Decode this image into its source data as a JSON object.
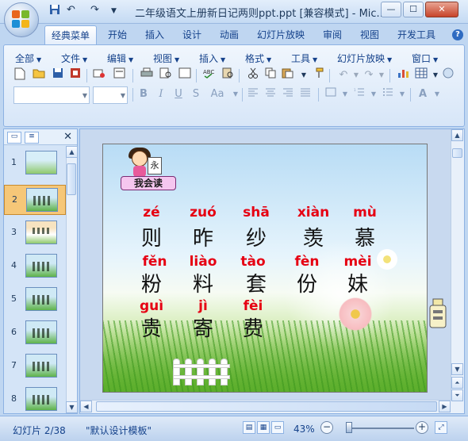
{
  "window": {
    "title": "二年级语文上册新日记两则ppt.ppt [兼容模式] - Mic...",
    "quick_access": {
      "save": "save-icon",
      "undo": "↶",
      "redo": "↷",
      "more": "▼"
    },
    "controls": {
      "min": "—",
      "max": "☐",
      "close": "✕"
    }
  },
  "tabs": [
    {
      "label": "经典菜单",
      "active": true
    },
    {
      "label": "开始"
    },
    {
      "label": "插入"
    },
    {
      "label": "设计"
    },
    {
      "label": "动画"
    },
    {
      "label": "幻灯片放映"
    },
    {
      "label": "审阅"
    },
    {
      "label": "视图"
    },
    {
      "label": "开发工具"
    }
  ],
  "help": "?",
  "menus": [
    "全部",
    "文件",
    "编辑",
    "视图",
    "插入",
    "格式",
    "工具",
    "幻灯片放映",
    "窗口"
  ],
  "format_toolbar": {
    "bold": "B",
    "italic": "I",
    "underline": "U",
    "strike": "S",
    "font_size": "Aa"
  },
  "slides_panel": {
    "tab_slides": "slides-tab-icon",
    "tab_outline": "outline-tab-icon",
    "close": "✕",
    "thumbnails": [
      "1",
      "2",
      "3",
      "4",
      "5",
      "6",
      "7",
      "8"
    ],
    "selected": 2
  },
  "slide": {
    "badge": "我会读",
    "book_char": "永",
    "rows": [
      [
        {
          "pinyin": "zé",
          "hanzi": "则"
        },
        {
          "pinyin": "zuó",
          "hanzi": "昨"
        },
        {
          "pinyin": "shā",
          "hanzi": "纱"
        },
        {
          "pinyin": "xiàn",
          "hanzi": "羡"
        },
        {
          "pinyin": "mù",
          "hanzi": "慕"
        }
      ],
      [
        {
          "pinyin": "fěn",
          "hanzi": "粉"
        },
        {
          "pinyin": "liào",
          "hanzi": "料"
        },
        {
          "pinyin": "tào",
          "hanzi": "套"
        },
        {
          "pinyin": "fèn",
          "hanzi": "份"
        },
        {
          "pinyin": "mèi",
          "hanzi": "妹"
        }
      ],
      [
        {
          "pinyin": "guì",
          "hanzi": "贵"
        },
        {
          "pinyin": "jì",
          "hanzi": "寄"
        },
        {
          "pinyin": "fèi",
          "hanzi": "费"
        }
      ]
    ]
  },
  "status": {
    "slide_info": "幻灯片 2/38",
    "template": "\"默认设计模板\"",
    "zoom": "43%",
    "zoom_out": "−",
    "zoom_in": "+"
  },
  "colors": {
    "pinyin": "#e60012",
    "hanzi": "#111111",
    "accent": "#15428b",
    "selected_thumb": "#f6c778"
  }
}
